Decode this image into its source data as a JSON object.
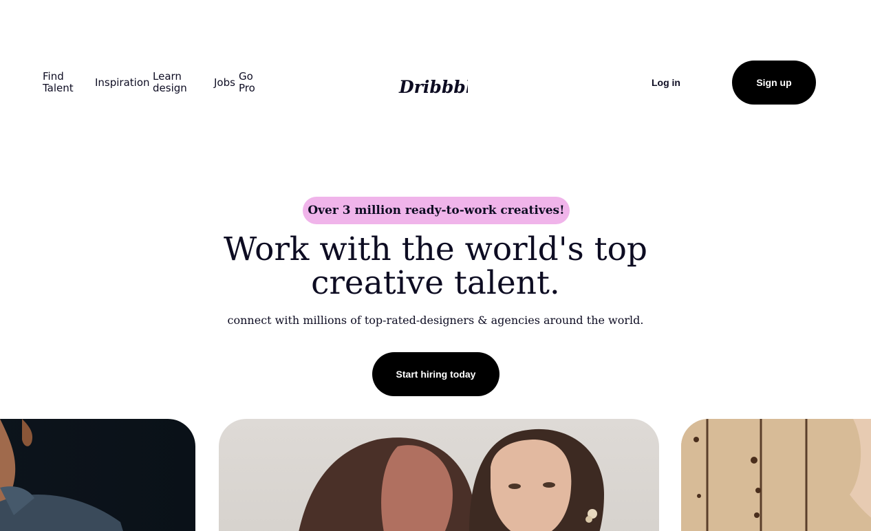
{
  "header": {
    "nav": [
      {
        "label": "Find Talent"
      },
      {
        "label": "Inspiration"
      },
      {
        "label": "Learn design"
      },
      {
        "label": "Jobs"
      },
      {
        "label": "Go Pro"
      }
    ],
    "logo_text": "Dribbble",
    "login_label": "Log in",
    "signup_label": "Sign up"
  },
  "hero": {
    "badge": "Over 3 million ready-to-work creatives!",
    "headline": "Work with the world's top creative talent.",
    "subheadline": "connect with millions of top-rated-designers & agencies around the world.",
    "cta_label": "Start hiring today"
  },
  "colors": {
    "badge_bg": "#f0b4ea",
    "button_bg": "#000000",
    "text": "#0d0c22"
  },
  "images": [
    {
      "name": "designer-portrait-man"
    },
    {
      "name": "two-women-portrait"
    },
    {
      "name": "wooden-panel-portrait"
    }
  ]
}
